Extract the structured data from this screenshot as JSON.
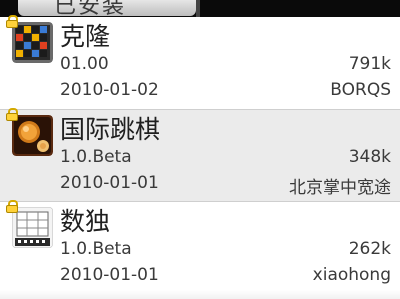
{
  "header": {
    "tab_label": "已安装"
  },
  "apps": [
    {
      "name": "克隆",
      "version": "01.00",
      "size": "791k",
      "date": "2010-01-02",
      "author": "BORQS",
      "icon": "grid-puzzle-icon"
    },
    {
      "name": "国际跳棋",
      "version": "1.0.Beta",
      "size": "348k",
      "date": "2010-01-01",
      "author": "北京掌中宽途",
      "icon": "checkers-icon"
    },
    {
      "name": "数独",
      "version": "1.0.Beta",
      "size": "262k",
      "date": "2010-01-01",
      "author": "xiaohong",
      "icon": "sudoku-icon"
    }
  ],
  "colors": {
    "row_alt": "#ebebeb",
    "tabbar": "#0a0a0a",
    "lock": "#ffd23a"
  }
}
